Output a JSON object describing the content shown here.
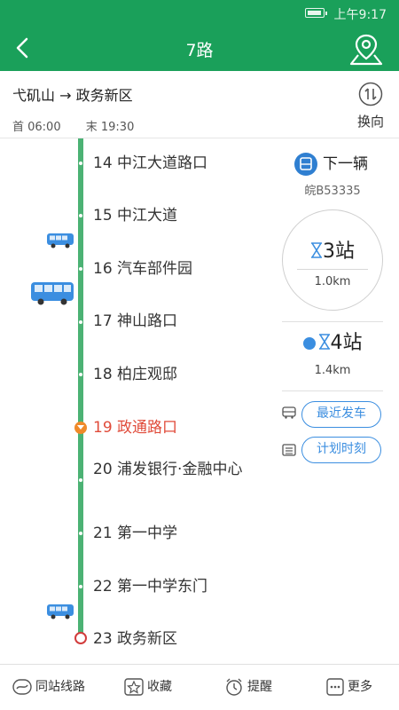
{
  "status_bar": {
    "time": "上午9:17"
  },
  "header": {
    "title": "7路"
  },
  "route": {
    "name": "弋矶山 → 政务新区",
    "first_bus": "首 06:00",
    "last_bus": "末 19:30",
    "swap_label": "换向"
  },
  "stations": [
    {
      "label": "14 中江大道路口"
    },
    {
      "label": "15 中江大道"
    },
    {
      "label": "16 汽车部件园"
    },
    {
      "label": "17 神山路口"
    },
    {
      "label": "18 柏庄观邸"
    },
    {
      "label": "19 政通路口",
      "current": true
    },
    {
      "label": "20 浦发银行·金融中心"
    },
    {
      "label": "21 第一中学"
    },
    {
      "label": "22 第一中学东门"
    },
    {
      "label": "23 政务新区"
    }
  ],
  "next_bus": {
    "title": "下一辆",
    "plate": "皖B53335",
    "first": {
      "stops": "3站",
      "distance": "1.0km"
    },
    "second": {
      "stops": "4站",
      "distance": "1.4km"
    }
  },
  "actions": {
    "latest": "最近发车",
    "schedule": "计划时刻"
  },
  "tabbar": {
    "same_station": "同站线路",
    "favorite": "收藏",
    "remind": "提醒",
    "more": "更多"
  },
  "colors": {
    "primary": "#1aa05a",
    "track": "#4cb274",
    "current": "#e04b3a",
    "accent": "#3b8ee0"
  }
}
